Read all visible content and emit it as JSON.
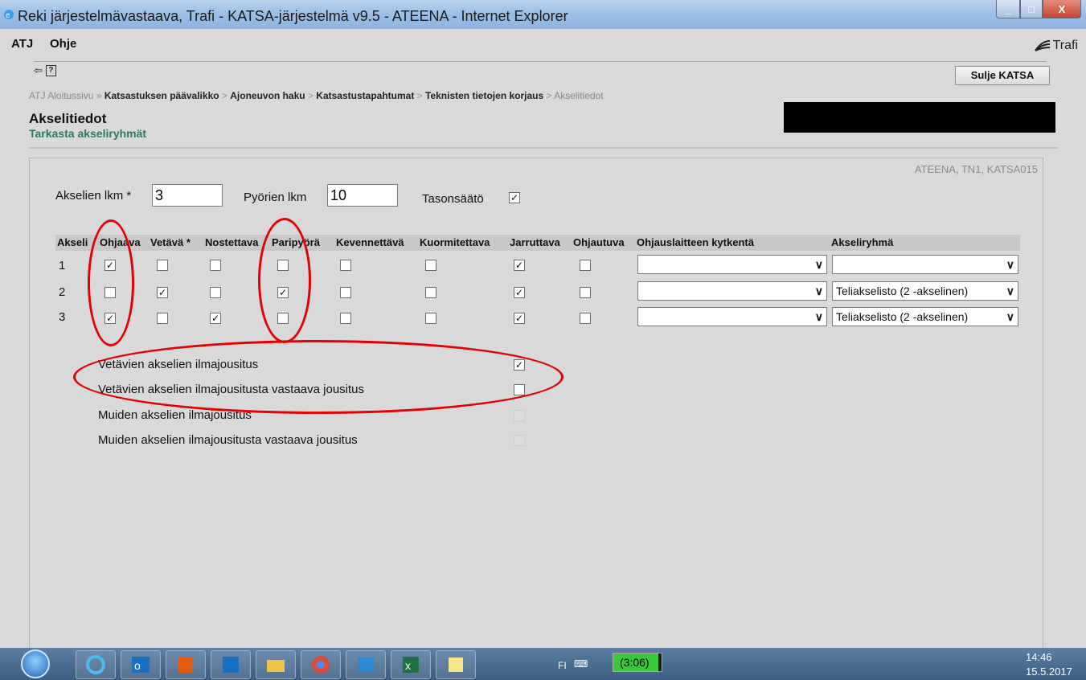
{
  "window": {
    "title": "Reki järjestelmävastaava, Trafi - KATSA-järjestelmä v9.5 - ATEENA - Internet Explorer"
  },
  "menu": {
    "items": [
      "ATJ",
      "Ohje"
    ],
    "logo": "Trafi"
  },
  "toolbar": {
    "back_symbol": "⇦",
    "help_symbol": "?",
    "close_label": "Sulje KATSA"
  },
  "breadcrumb": {
    "items": [
      "ATJ Aloitussivu",
      "Katsastuksen päävalikko",
      "Ajoneuvon haku",
      "Katsastustapahtumat",
      "Teknisten tietojen korjaus",
      "Akselitiedot"
    ]
  },
  "page": {
    "title": "Akselitiedot",
    "subtitle": "Tarkasta akseliryhmät",
    "panel_id": "ATEENA, TN1, KATSA015"
  },
  "form": {
    "axle_count_label": "Akselien lkm *",
    "axle_count": "3",
    "wheel_count_label": "Pyörien lkm",
    "wheel_count": "10",
    "leveling_label": "Tasonsäätö",
    "leveling_checked": true
  },
  "table": {
    "headers": [
      "Akseli",
      "Ohjaava",
      "Vetävä *",
      "Nostettava",
      "Paripyörä",
      "Kevennettävä",
      "Kuormitettava",
      "Jarruttava",
      "Ohjautuva",
      "Ohjauslaitteen kytkentä",
      "Akseliryhmä"
    ],
    "rows": [
      {
        "axle": "1",
        "checks": [
          true,
          false,
          false,
          false,
          false,
          false,
          true,
          false
        ],
        "steering_link": "",
        "group": ""
      },
      {
        "axle": "2",
        "checks": [
          false,
          true,
          false,
          true,
          false,
          false,
          true,
          false
        ],
        "steering_link": "",
        "group": "Teliakselisto (2 -akselinen)"
      },
      {
        "axle": "3",
        "checks": [
          true,
          false,
          true,
          false,
          false,
          false,
          true,
          false
        ],
        "steering_link": "",
        "group": "Teliakselisto (2 -akselinen)"
      }
    ]
  },
  "suspension": [
    {
      "label": "Vetävien akselien ilmajousitus",
      "checked": true,
      "enabled": true
    },
    {
      "label": "Vetävien akselien ilmajousitusta vastaava jousitus",
      "checked": false,
      "enabled": true
    },
    {
      "label": "Muiden akselien ilmajousitus",
      "checked": false,
      "enabled": false
    },
    {
      "label": "Muiden akselien ilmajousitusta vastaava jousitus",
      "checked": false,
      "enabled": false
    }
  ],
  "taskbar": {
    "lang": "FI",
    "battery_time": "(3:06)",
    "time": "14:46",
    "date": "15.5.2017"
  },
  "colors": {
    "annotation": "#e40000",
    "subtitle": "#2a7a5a",
    "title_bar": "#9ebfe6"
  }
}
